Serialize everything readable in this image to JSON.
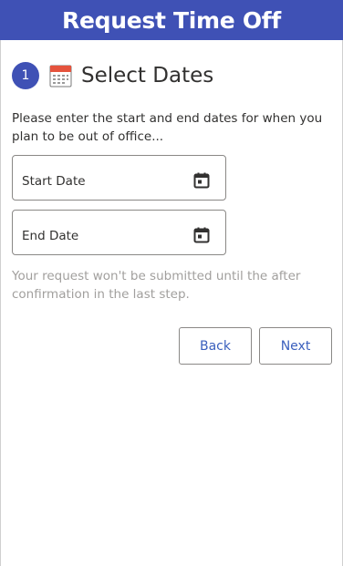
{
  "header": {
    "title": "Request Time Off"
  },
  "step": {
    "number": "1",
    "icon": "calendar-emoji-icon",
    "title": "Select Dates"
  },
  "instructions": "Please enter the start and end dates for when you plan to be out of office...",
  "fields": {
    "start_date": {
      "label": "Start Date",
      "icon": "calendar-icon"
    },
    "end_date": {
      "label": "End Date",
      "icon": "calendar-icon"
    }
  },
  "note": "Your request won't be submitted until the after confirmation in the last step.",
  "buttons": {
    "back": "Back",
    "next": "Next"
  },
  "colors": {
    "accent": "#3f51b5",
    "button_text": "#3a5fbd",
    "muted_text": "#a19f9d",
    "border": "#8a8886"
  }
}
